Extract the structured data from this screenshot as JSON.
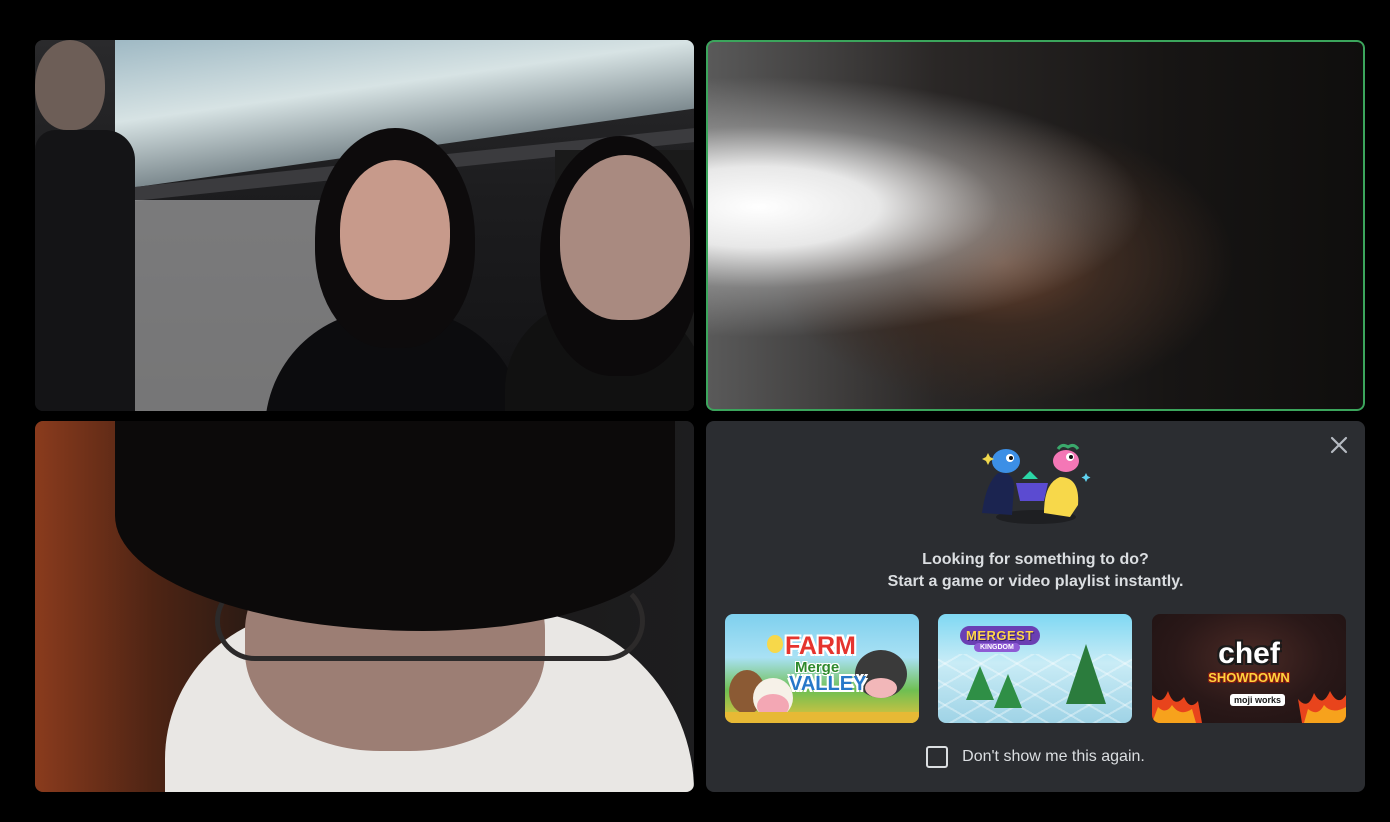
{
  "activity_prompt": {
    "line1": "Looking for something to do?",
    "line2": "Start a game or video playlist instantly.",
    "dont_show_label": "Don't show me this again.",
    "dont_show_checked": false
  },
  "games": [
    {
      "title": "FARM",
      "subtitle": "Merge",
      "subtitle2": "VALLEY"
    },
    {
      "title": "MERGEST",
      "subtitle": "KINGDOM"
    },
    {
      "title": "chef",
      "subtitle": "SHOWDOWN",
      "brand": "moji works"
    }
  ],
  "colors": {
    "background": "#000000",
    "card_bg": "#2b2d31",
    "speaking_ring": "#3ba55c",
    "text": "#dbdee1"
  },
  "icons": {
    "close": "close-icon",
    "illustration": "activity-characters-illustration"
  }
}
